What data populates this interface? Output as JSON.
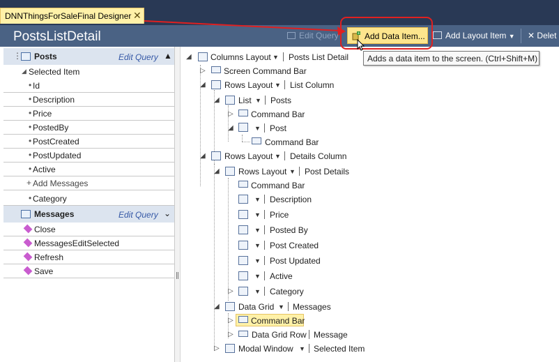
{
  "tab": {
    "title": "DNNThingsForSaleFinal Designer",
    "close": "✕"
  },
  "screen": {
    "title": "PostsListDetail"
  },
  "toolbar": {
    "edit_query": "Edit Query",
    "add_data_item": "Add Data Item...",
    "add_layout_item": "Add Layout Item",
    "delete": "Delet"
  },
  "tooltip": "Adds a data item to the screen. (Ctrl+Shift+M)",
  "left": {
    "posts_group": {
      "title": "Posts",
      "edit_query": "Edit Query"
    },
    "selected_item": "Selected Item",
    "fields": [
      "Id",
      "Description",
      "Price",
      "PostedBy",
      "PostCreated",
      "PostUpdated",
      "Active"
    ],
    "add_messages": "Add Messages",
    "category": "Category",
    "messages_group": {
      "title": "Messages",
      "edit_query": "Edit Query"
    },
    "commands": [
      "Close",
      "MessagesEditSelected",
      "Refresh",
      "Save"
    ]
  },
  "tree": {
    "columns_layout": "Columns Layout",
    "posts_list_detail": "Posts List Detail",
    "screen_command_bar": "Screen Command Bar",
    "rows_layout": "Rows Layout",
    "list_column": "List Column",
    "list": "List",
    "posts": "Posts",
    "command_bar": "Command Bar",
    "post": "Post",
    "details_column": "Details Column",
    "post_details": "Post Details",
    "description": "Description",
    "price": "Price",
    "posted_by": "Posted By",
    "post_created": "Post Created",
    "post_updated": "Post Updated",
    "active": "Active",
    "category": "Category",
    "data_grid": "Data Grid",
    "messages": "Messages",
    "data_grid_row": "Data Grid Row",
    "message": "Message",
    "modal_window": "Modal Window",
    "selected_item": "Selected Item"
  },
  "colors": {
    "chrome": "#293955",
    "header": "#4a6284",
    "highlight": "#fff1a8",
    "callout": "#e02020"
  }
}
